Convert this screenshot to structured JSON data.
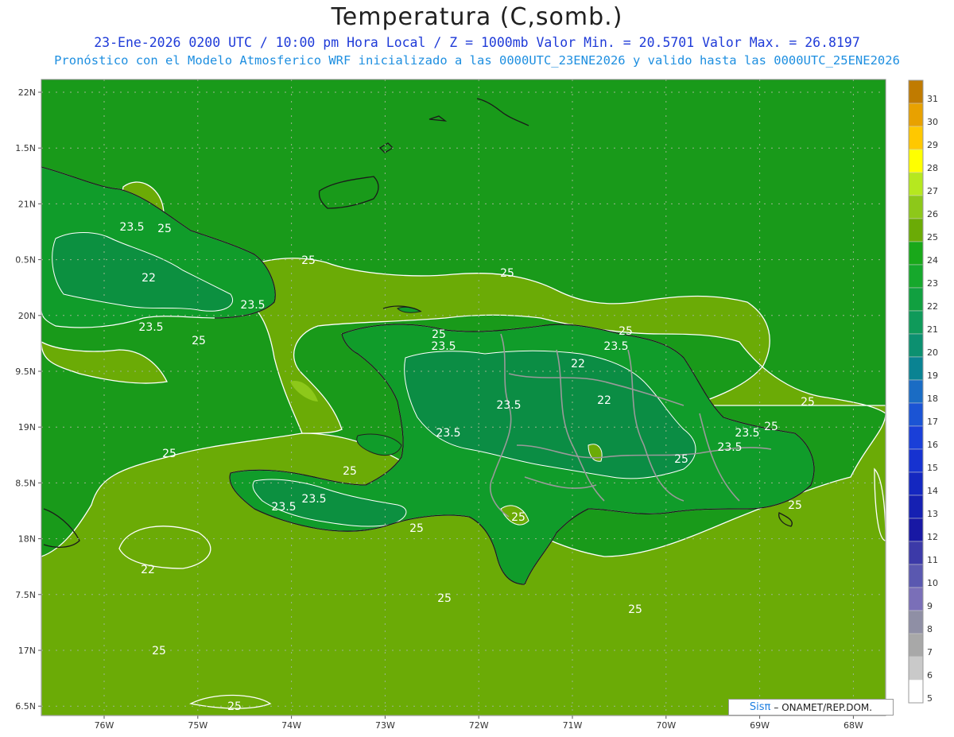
{
  "header": {
    "title": "Temperatura (C,somb.)",
    "line1": "23-Ene-2026 0200 UTC / 10:00 pm Hora Local / Z = 1000mb  Valor Min. = 20.5701  Valor Max. = 26.8197",
    "line2": "Pronóstico con el Modelo Atmosferico WRF inicializado a las 0000UTC_23ENE2026 y valido hasta las  0000UTC_25ENE2026"
  },
  "map": {
    "lat_labels": [
      "22N",
      "1.5N",
      "21N",
      "0.5N",
      "20N",
      "9.5N",
      "19N",
      "8.5N",
      "18N",
      "7.5N",
      "17N",
      "6.5N"
    ],
    "lon_labels": [
      "76W",
      "75W",
      "74W",
      "73W",
      "72W",
      "71W",
      "70W",
      "69W",
      "68W"
    ],
    "contour_labels": [
      "23.5",
      "25",
      "22",
      "23.5",
      "25",
      "25",
      "25",
      "23.5",
      "22",
      "25",
      "23.5",
      "22",
      "23.5",
      "25",
      "25",
      "23.5",
      "25",
      "23.5",
      "25",
      "25",
      "25",
      "25",
      "25",
      "25",
      "25",
      "25",
      "22",
      "23.5",
      "23.5",
      "25",
      "23.5",
      "23.5",
      "25"
    ],
    "colors": {
      "sea_warm": "#6bab06",
      "land_cool": "#0e9e24",
      "land_coolest": "#0a8c48",
      "ocean_mid": "#199a1a"
    }
  },
  "legend": {
    "levels": [
      "31",
      "30",
      "29",
      "28",
      "27",
      "26",
      "25",
      "24",
      "23",
      "22",
      "21",
      "20",
      "19",
      "18",
      "17",
      "16",
      "15",
      "14",
      "13",
      "12",
      "11",
      "10",
      "9",
      "8",
      "7",
      "6",
      "5"
    ],
    "colors": [
      "#c07b00",
      "#e8a100",
      "#ffc800",
      "#ffff00",
      "#b6e81f",
      "#8dc81a",
      "#6bab06",
      "#19a81a",
      "#16a82c",
      "#11a040",
      "#0f9a5a",
      "#0c9070",
      "#0a8392",
      "#1a6cc4",
      "#1b54d4",
      "#1a3fd8",
      "#1632d0",
      "#1427c0",
      "#1520b2",
      "#1818a4",
      "#3c3aa8",
      "#5a58b0",
      "#7a6fb8",
      "#8f8fa5",
      "#a8a8a8",
      "#c9c9c9",
      "#ffffff"
    ]
  },
  "credit": {
    "brand": "Sisπ",
    "text": "– ONAMET/REP.DOM."
  }
}
